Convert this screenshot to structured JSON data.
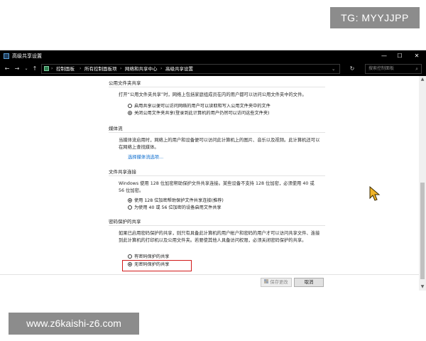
{
  "overlay": {
    "tg_badge": "TG: MYYJJPP",
    "watermark": "www.z6kaishi-z6.com"
  },
  "window": {
    "title": "高级共享设置",
    "minimize": "—",
    "maximize": "☐",
    "close": "✕"
  },
  "nav": {
    "back": "←",
    "forward": "→",
    "recent": "⌄",
    "up": "↑",
    "refresh": "↻",
    "dropdown": "⌄"
  },
  "breadcrumb": [
    "控制面板",
    "所有控制面板项",
    "网络和共享中心",
    "高级共享设置"
  ],
  "search": {
    "placeholder": "搜索控制面板",
    "icon": "⌕"
  },
  "sections": {
    "public_folder": {
      "title": "公用文件夹共享",
      "desc": "打开“公用文件夹共享”时，网络上包括家庭组成员在内的用户都可以访问公用文件夹中的文件。",
      "options": [
        {
          "label": "启用共享以便可以访问网络的用户可以读取和写入公用文件夹中的文件",
          "checked": false
        },
        {
          "label": "关闭公用文件夹共享(登录到此计算机的用户仍然可以访问这些文件夹)",
          "checked": true
        }
      ]
    },
    "media_streaming": {
      "title": "媒体流",
      "desc": "当媒体流启用时，网络上的用户和设备便可以访问此计算机上的图片、音乐以及视频。此计算机还可以在网络上查找媒体。",
      "link": "选择媒体流选项..."
    },
    "file_sharing": {
      "title": "文件共享连接",
      "desc": "Windows 使用 128 位加密帮助保护文件共享连接。某些设备不支持 128 位加密，必须使用 40 或 56 位加密。",
      "options": [
        {
          "label": "使用 128 位加密帮助保护文件共享连接(推荐)",
          "checked": true
        },
        {
          "label": "为使用 40 或 56 位加密的设备启用文件共享",
          "checked": false
        }
      ]
    },
    "password_sharing": {
      "title": "密码保护的共享",
      "desc": "如果已启用密码保护的共享，则只有具备此计算机的用户帐户和密码的用户才可以访问共享文件、连接到此计算机的打印机以及公用文件夹。若要使其他人具备访问权限，必须关闭密码保护的共享。",
      "options": [
        {
          "label": "有密码保护的共享",
          "checked": false
        },
        {
          "label": "无密码保护的共享",
          "checked": true
        }
      ]
    }
  },
  "footer": {
    "save": "保存更改",
    "cancel": "取消"
  },
  "colors": {
    "highlight": "#d21a1a",
    "link": "#0066cc",
    "titlebar": "#000000"
  }
}
